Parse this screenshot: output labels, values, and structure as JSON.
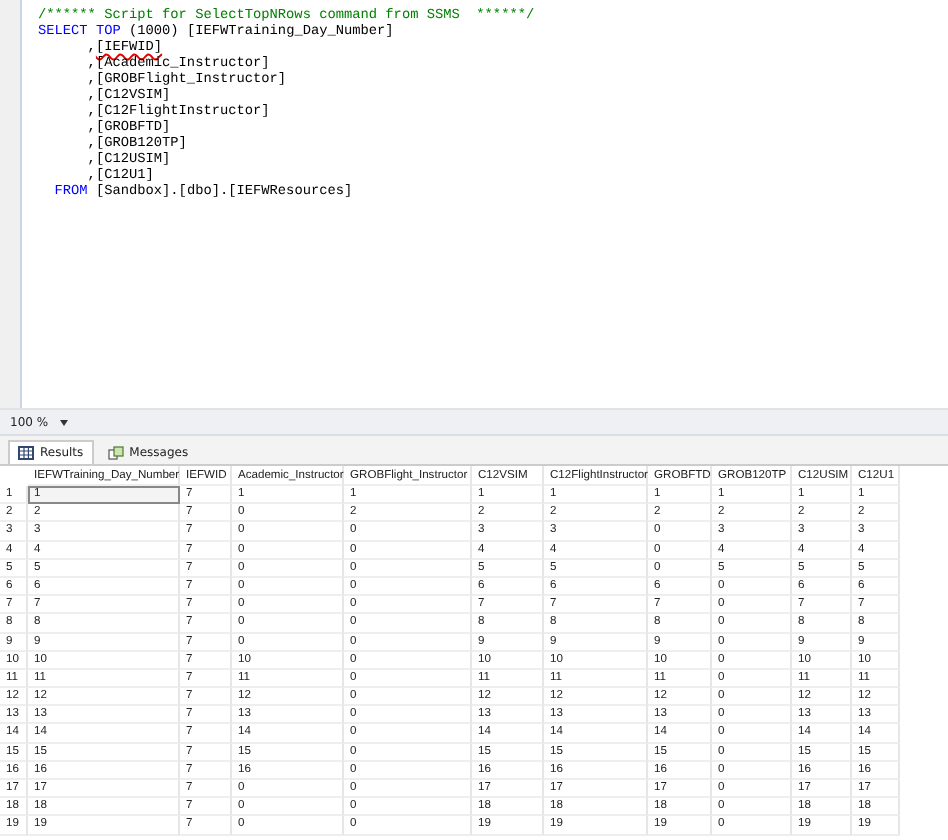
{
  "editor": {
    "lines": [
      [
        {
          "text": "/****** Script for SelectTopNRows command from SSMS  ******/",
          "kind": "comment"
        }
      ],
      [
        {
          "text": "SELECT TOP ",
          "kind": "keyword"
        },
        {
          "text": "(1000) [IEFWTraining_Day_Number]",
          "kind": "plain"
        }
      ],
      [
        {
          "text": "      ,",
          "kind": "plain"
        },
        {
          "text": "[IEFWID]",
          "kind": "error"
        }
      ],
      [
        {
          "text": "      ,[Academic_Instructor]",
          "kind": "plain"
        }
      ],
      [
        {
          "text": "      ,[GROBFlight_Instructor]",
          "kind": "plain"
        }
      ],
      [
        {
          "text": "      ,[C12VSIM]",
          "kind": "plain"
        }
      ],
      [
        {
          "text": "      ,[C12FlightInstructor]",
          "kind": "plain"
        }
      ],
      [
        {
          "text": "      ,[GROBFTD]",
          "kind": "plain"
        }
      ],
      [
        {
          "text": "      ,[GROB120TP]",
          "kind": "plain"
        }
      ],
      [
        {
          "text": "      ,[C12USIM]",
          "kind": "plain"
        }
      ],
      [
        {
          "text": "      ,[C12U1]",
          "kind": "plain"
        }
      ],
      [
        {
          "text": "  FROM ",
          "kind": "keyword"
        },
        {
          "text": "[Sandbox].[dbo].[IEFWResources]",
          "kind": "plain"
        }
      ]
    ]
  },
  "zoom": "100 %",
  "tabs": [
    {
      "label": "Results",
      "selected": true
    },
    {
      "label": "Messages",
      "selected": false
    }
  ],
  "results": {
    "columns": [
      "IEFWTraining_Day_Number",
      "IEFWID",
      "Academic_Instructor",
      "GROBFlight_Instructor",
      "C12VSIM",
      "C12FlightInstructor",
      "GROBFTD",
      "GROB120TP",
      "C12USIM",
      "C12U1"
    ],
    "rows": [
      {
        "number": "1",
        "selected": true,
        "cells": [
          "1",
          "7",
          "1",
          "1",
          "1",
          "1",
          "1",
          "1",
          "1",
          "1"
        ]
      },
      {
        "number": "2",
        "selected": false,
        "cells": [
          "2",
          "7",
          "0",
          "2",
          "2",
          "2",
          "2",
          "2",
          "2",
          "2"
        ]
      },
      {
        "number": "3",
        "selected": false,
        "cells": [
          "3",
          "7",
          "0",
          "0",
          "3",
          "3",
          "0",
          "3",
          "3",
          "3"
        ]
      },
      {
        "number": "4",
        "selected": false,
        "cells": [
          "4",
          "7",
          "0",
          "0",
          "4",
          "4",
          "0",
          "4",
          "4",
          "4"
        ]
      },
      {
        "number": "5",
        "selected": false,
        "cells": [
          "5",
          "7",
          "0",
          "0",
          "5",
          "5",
          "0",
          "5",
          "5",
          "5"
        ]
      },
      {
        "number": "6",
        "selected": false,
        "cells": [
          "6",
          "7",
          "0",
          "0",
          "6",
          "6",
          "6",
          "0",
          "6",
          "6"
        ]
      },
      {
        "number": "7",
        "selected": false,
        "cells": [
          "7",
          "7",
          "0",
          "0",
          "7",
          "7",
          "7",
          "0",
          "7",
          "7"
        ]
      },
      {
        "number": "8",
        "selected": false,
        "cells": [
          "8",
          "7",
          "0",
          "0",
          "8",
          "8",
          "8",
          "0",
          "8",
          "8"
        ]
      },
      {
        "number": "9",
        "selected": false,
        "cells": [
          "9",
          "7",
          "0",
          "0",
          "9",
          "9",
          "9",
          "0",
          "9",
          "9"
        ]
      },
      {
        "number": "10",
        "selected": false,
        "cells": [
          "10",
          "7",
          "10",
          "0",
          "10",
          "10",
          "10",
          "0",
          "10",
          "10"
        ]
      },
      {
        "number": "11",
        "selected": false,
        "cells": [
          "11",
          "7",
          "11",
          "0",
          "11",
          "11",
          "11",
          "0",
          "11",
          "11"
        ]
      },
      {
        "number": "12",
        "selected": false,
        "cells": [
          "12",
          "7",
          "12",
          "0",
          "12",
          "12",
          "12",
          "0",
          "12",
          "12"
        ]
      },
      {
        "number": "13",
        "selected": false,
        "cells": [
          "13",
          "7",
          "13",
          "0",
          "13",
          "13",
          "13",
          "0",
          "13",
          "13"
        ]
      },
      {
        "number": "14",
        "selected": false,
        "cells": [
          "14",
          "7",
          "14",
          "0",
          "14",
          "14",
          "14",
          "0",
          "14",
          "14"
        ]
      },
      {
        "number": "15",
        "selected": false,
        "cells": [
          "15",
          "7",
          "15",
          "0",
          "15",
          "15",
          "15",
          "0",
          "15",
          "15"
        ]
      },
      {
        "number": "16",
        "selected": false,
        "cells": [
          "16",
          "7",
          "16",
          "0",
          "16",
          "16",
          "16",
          "0",
          "16",
          "16"
        ]
      },
      {
        "number": "17",
        "selected": false,
        "cells": [
          "17",
          "7",
          "0",
          "0",
          "17",
          "17",
          "17",
          "0",
          "17",
          "17"
        ]
      },
      {
        "number": "18",
        "selected": false,
        "cells": [
          "18",
          "7",
          "0",
          "0",
          "18",
          "18",
          "18",
          "0",
          "18",
          "18"
        ]
      },
      {
        "number": "19",
        "selected": false,
        "cells": [
          "19",
          "7",
          "0",
          "0",
          "19",
          "19",
          "19",
          "0",
          "19",
          "19"
        ]
      }
    ]
  }
}
